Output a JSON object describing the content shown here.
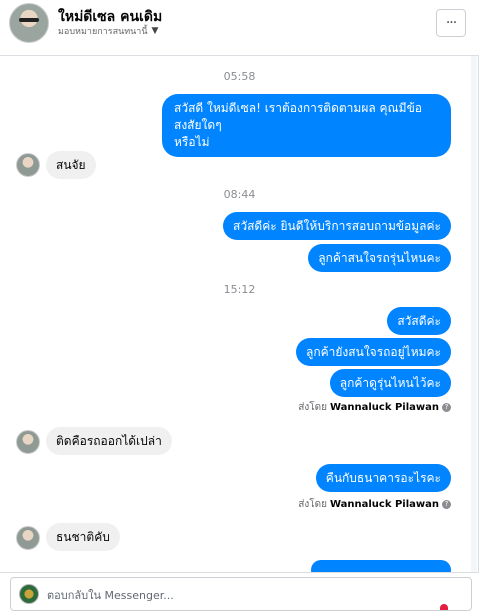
{
  "header": {
    "contact_name": "ใหม่ดีเซล คนเดิม",
    "assign_label": "มอบหมายการสนทนานี้",
    "more_label": "···"
  },
  "thread": {
    "timestamps": [
      "05:58",
      "08:44",
      "15:12"
    ],
    "messages": [
      {
        "dir": "out",
        "line1": "สวัสดี ใหม่ดีเซล! เราต้องการติดตามผล คุณมีข้อสงสัยใดๆ",
        "line2": "หรือไม่"
      },
      {
        "dir": "in",
        "text": "สนจัย"
      },
      {
        "dir": "out",
        "text": "สวัสดีค่ะ  ยินดีให้บริการสอบถามข้อมูลค่ะ"
      },
      {
        "dir": "out",
        "text": "ลูกค้าสนใจรถรุ่นไหนคะ"
      },
      {
        "dir": "out",
        "text": "สวัสดีค่ะ"
      },
      {
        "dir": "out",
        "text": "ลูกค้ายังสนใจรถอยู่ไหมคะ"
      },
      {
        "dir": "out",
        "text": "ลูกค้าดูรุ่นไหนไว้คะ"
      },
      {
        "dir": "in",
        "text": "ติดคือรถออกได้เปล่า"
      },
      {
        "dir": "out",
        "text": "คืนกับธนาคารอะไรคะ"
      },
      {
        "dir": "in",
        "text": "ธนชาติคับ"
      }
    ],
    "sent_by_prefix": "ส่งโดย",
    "sent_by_name": "Wannaluck Pilawan"
  },
  "composer": {
    "placeholder": "ตอบกลับใน Messenger..."
  },
  "colors": {
    "outgoing_bubble": "#0084ff",
    "incoming_bubble": "#f0f0f0"
  },
  "icons": [
    "more-icon",
    "chevron-down-icon",
    "info-icon"
  ]
}
